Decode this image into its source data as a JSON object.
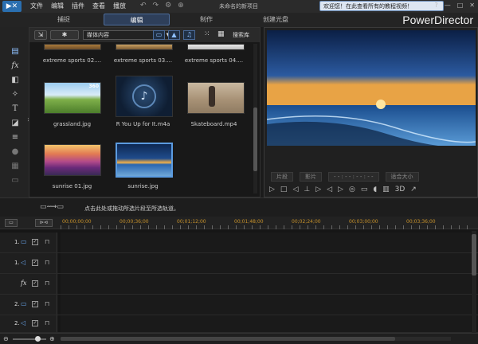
{
  "titlebar": {
    "logo": "▶✕",
    "menu": [
      "文件",
      "编辑",
      "插件",
      "查看",
      "播放"
    ],
    "project_name": "未命名的新项目",
    "notice": "欢迎您！在此查看所有的教程视频！",
    "window_controls": [
      "?",
      "—",
      "□",
      "✕"
    ]
  },
  "modes": {
    "capture": "捕捉",
    "edit": "编辑",
    "produce": "制作",
    "disc": "创建光盘",
    "brand": "PowerDirector"
  },
  "library": {
    "import_icon": "import-icon",
    "plugin_icon": "puzzle-icon",
    "content_select": "媒体内容",
    "search_label": "搜索库",
    "items": [
      {
        "label": "extreme sports 02....",
        "kind": "top-partial"
      },
      {
        "label": "extreme sports 03....",
        "kind": "top-partial"
      },
      {
        "label": "extreme sports 04....",
        "kind": "top-partial"
      },
      {
        "label": "grassland.jpg",
        "kind": "grassland",
        "badge": "360"
      },
      {
        "label": "R You Up for It.m4a",
        "kind": "audio"
      },
      {
        "label": "Skateboard.mp4",
        "kind": "skate"
      },
      {
        "label": "sunrise 01.jpg",
        "kind": "sunrise01"
      },
      {
        "label": "sunrise.jpg",
        "kind": "sunrise",
        "selected": true
      }
    ]
  },
  "preview": {
    "mode_clip": "片段",
    "mode_movie": "影片",
    "timecode": "- - : - - : - - : - -",
    "fit": "适合大小",
    "three_d": "3D"
  },
  "instructions": {
    "text": "点击此处或拖动所选片段至所选轨道。"
  },
  "timeline": {
    "ruler_labels": [
      "00;00;00;00",
      "00;00;36;00",
      "00;01;12;00",
      "00;01;48;00",
      "00;02;24;00",
      "00;03;00;00",
      "00;03;36;00"
    ],
    "tracks": [
      {
        "num": "1.",
        "type": "video"
      },
      {
        "num": "1.",
        "type": "audio"
      },
      {
        "num": "",
        "type": "fx"
      },
      {
        "num": "2.",
        "type": "video"
      },
      {
        "num": "2.",
        "type": "audio"
      }
    ]
  }
}
